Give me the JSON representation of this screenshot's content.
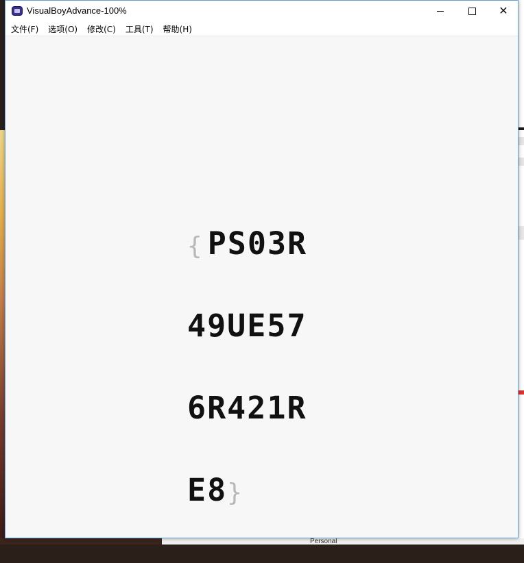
{
  "window": {
    "title": "VisualBoyAdvance-100%",
    "minimize": "",
    "maximize": "",
    "close": "✕"
  },
  "menu": [
    {
      "label": "文件(F)"
    },
    {
      "label": "选项(O)"
    },
    {
      "label": "修改(C)"
    },
    {
      "label": "工具(T)"
    },
    {
      "label": "帮助(H)"
    }
  ],
  "game_screen": {
    "open_brace": "{",
    "lines": [
      "PS03R",
      "49UE57",
      "6R421R",
      "E8"
    ],
    "close_brace": "}"
  },
  "background": {
    "taskbar_label": "Personal"
  }
}
